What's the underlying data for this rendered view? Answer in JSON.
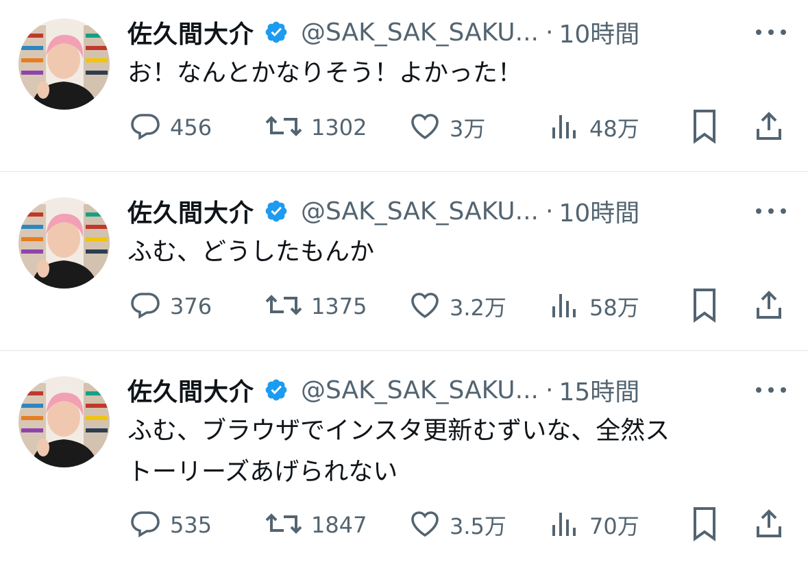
{
  "tweets": [
    {
      "name": "佐久間大介",
      "handle": "@SAK_SAK_SAKU...",
      "separator": "·",
      "time": "10時間",
      "text": "お！なんとかなりそう！よかった！",
      "replies": "456",
      "retweets": "1302",
      "likes": "3万",
      "views": "48万"
    },
    {
      "name": "佐久間大介",
      "handle": "@SAK_SAK_SAKU...",
      "separator": "·",
      "time": "10時間",
      "text": "ふむ、どうしたもんか",
      "replies": "376",
      "retweets": "1375",
      "likes": "3.2万",
      "views": "58万"
    },
    {
      "name": "佐久間大介",
      "handle": "@SAK_SAK_SAKU...",
      "separator": "·",
      "time": "15時間",
      "text_line1": "ふむ、ブラウザでインスタ更新むずいな、全然ス",
      "text_line2": "トーリーズあげられない",
      "replies": "535",
      "retweets": "1847",
      "likes": "3.5万",
      "views": "70万"
    }
  ],
  "icons": {
    "verified": "verified-badge-icon",
    "reply": "reply-icon",
    "retweet": "retweet-icon",
    "like": "heart-icon",
    "views": "views-icon",
    "bookmark": "bookmark-icon",
    "share": "share-icon",
    "more": "more-icon"
  },
  "colors": {
    "verified": "#1d9bf0",
    "secondary_text": "#536471",
    "primary_text": "#0f1419",
    "divider": "#e2e6e9"
  }
}
